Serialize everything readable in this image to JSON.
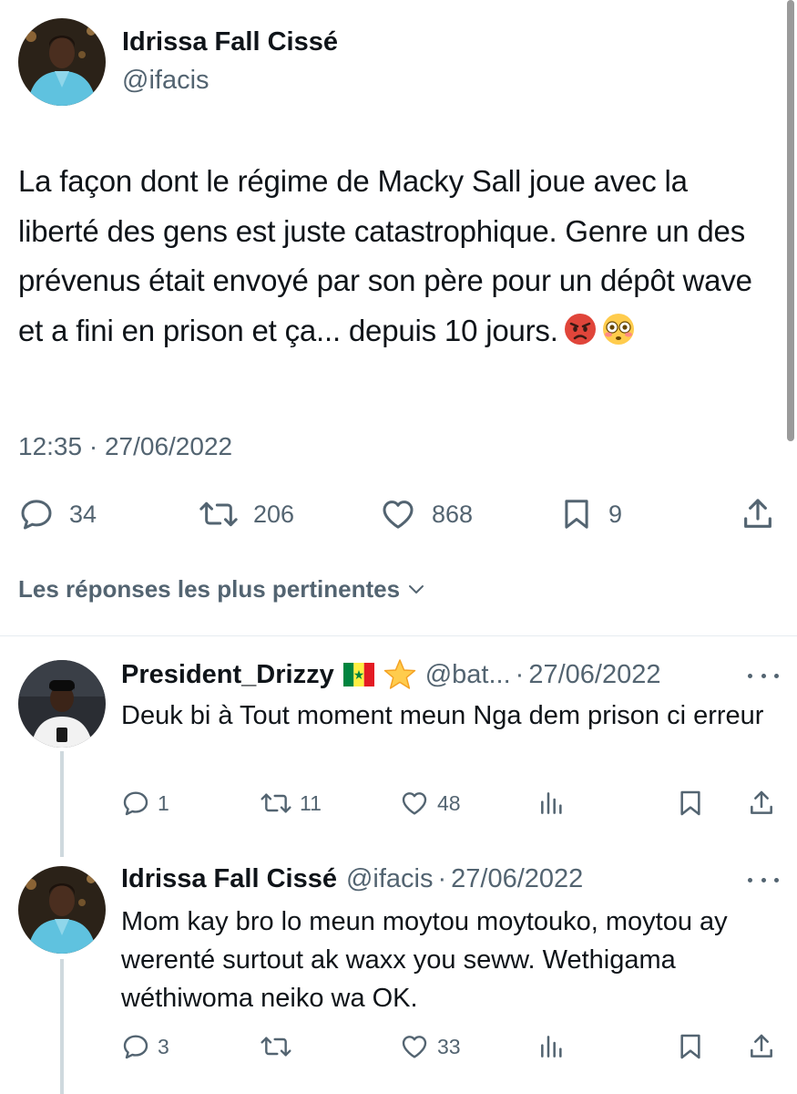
{
  "main_tweet": {
    "author_name": "Idrissa Fall Cissé",
    "author_handle": "@ifacis",
    "text": "La façon dont le régime de Macky Sall joue avec la liberté des gens est juste catastrophique. Genre un des prévenus était envoyé par son père pour un dépôt wave et a fini en prison et ça... depuis 10 jours.",
    "timestamp": "12:35 · 27/06/2022",
    "stats": {
      "replies": "34",
      "retweets": "206",
      "likes": "868",
      "bookmarks": "9"
    }
  },
  "sort_label": "Les réponses les plus pertinentes",
  "replies": [
    {
      "author_name": "President_Drizzy",
      "flag_emoji": "🇸🇳",
      "star_emoji": "⭐",
      "author_handle": "@bat...",
      "separator": "·",
      "date": "27/06/2022",
      "text": "Deuk bi à Tout moment meun Nga dem prison ci erreur",
      "stats": {
        "replies": "1",
        "retweets": "11",
        "likes": "48"
      }
    },
    {
      "author_name": "Idrissa Fall Cissé",
      "author_handle": "@ifacis",
      "separator": "·",
      "date": "27/06/2022",
      "text": "Mom kay bro lo meun moytou moytouko, moytou ay werenté surtout ak waxx you seww. Wethigama wéthiwoma neiko wa OK.",
      "stats": {
        "replies": "3",
        "retweets": "",
        "likes": "33"
      }
    }
  ],
  "icons": {
    "reply": "reply-icon",
    "retweet": "retweet-icon",
    "like": "heart-icon",
    "bookmark": "bookmark-icon",
    "share": "share-icon",
    "views": "analytics-icon",
    "more": "more-icon",
    "chevron": "chevron-down-icon",
    "emoji_1": "angry-face-emoji",
    "emoji_2": "flushed-face-emoji"
  },
  "colors": {
    "text_primary": "#0f1419",
    "text_secondary": "#536471",
    "thread_line": "#cfd9de",
    "senegal_green": "#00853f",
    "senegal_yellow": "#fdef42",
    "senegal_red": "#e31b23"
  }
}
